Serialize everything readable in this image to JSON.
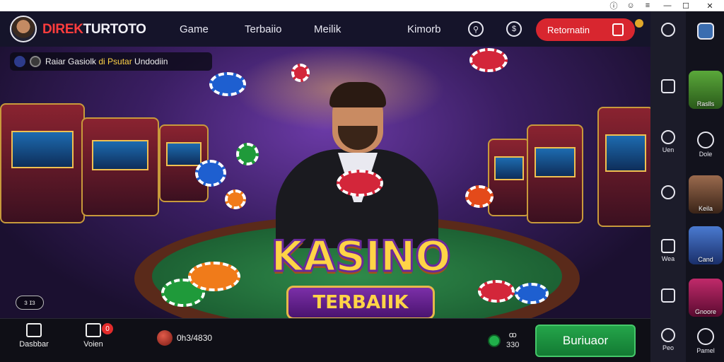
{
  "window": {
    "controls": [
      "ⓘ",
      "☺",
      "≡",
      "—",
      "☐",
      "✕"
    ]
  },
  "header": {
    "brand_part1": "DIREK",
    "brand_part2": "TURTOTO",
    "nav": [
      "Game",
      "Terbaiio",
      "Meilik",
      "Kimorb"
    ],
    "login_label": "Retornatin"
  },
  "hero": {
    "marquee_prefix": "Raiar Gasiolk ",
    "marquee_highlight": "di Psutar",
    "marquee_suffix": " Undodiin",
    "title_line1": "KASINO",
    "title_line2": "TERBAIIK",
    "side_pill": "ɜ ɪɜ"
  },
  "bottom_bar": {
    "home_label": "Dasbbar",
    "mail_label": "Voien",
    "mail_badge": "0",
    "balance": "0h3/4830",
    "count_top": "ꝏ",
    "count_bottom": "330",
    "cta_label": "Buriuaor"
  },
  "tool_rail": {
    "items": [
      {
        "icon": "pen-icon",
        "label": ""
      },
      {
        "icon": "square-icon",
        "label": ""
      },
      {
        "icon": "location-icon",
        "label": "Uen"
      },
      {
        "icon": "chat-icon",
        "label": ""
      },
      {
        "icon": "copy-icon",
        "label": "Wea"
      },
      {
        "icon": "window-icon",
        "label": ""
      },
      {
        "icon": "settings-icon",
        "label": "Peo"
      }
    ]
  },
  "app_rail": {
    "tiles": [
      {
        "label": "",
        "icon": "home-cube-icon"
      },
      {
        "label": "Raslls",
        "color": "#3f8a2a"
      },
      {
        "label": "Dole",
        "icon": "smile-icon"
      },
      {
        "label": "Keila",
        "color": "#6b3f2e"
      },
      {
        "label": "Cand",
        "color": "#2b4f9a"
      },
      {
        "label": "Gnoore",
        "color": "#8a1a4a"
      },
      {
        "label": "Pamel",
        "icon": "search-icon"
      }
    ]
  },
  "colors": {
    "brand_red": "#ff3d3d",
    "login_red": "#d8262f",
    "cta_green": "#24a54a",
    "gold": "#ffd447"
  }
}
